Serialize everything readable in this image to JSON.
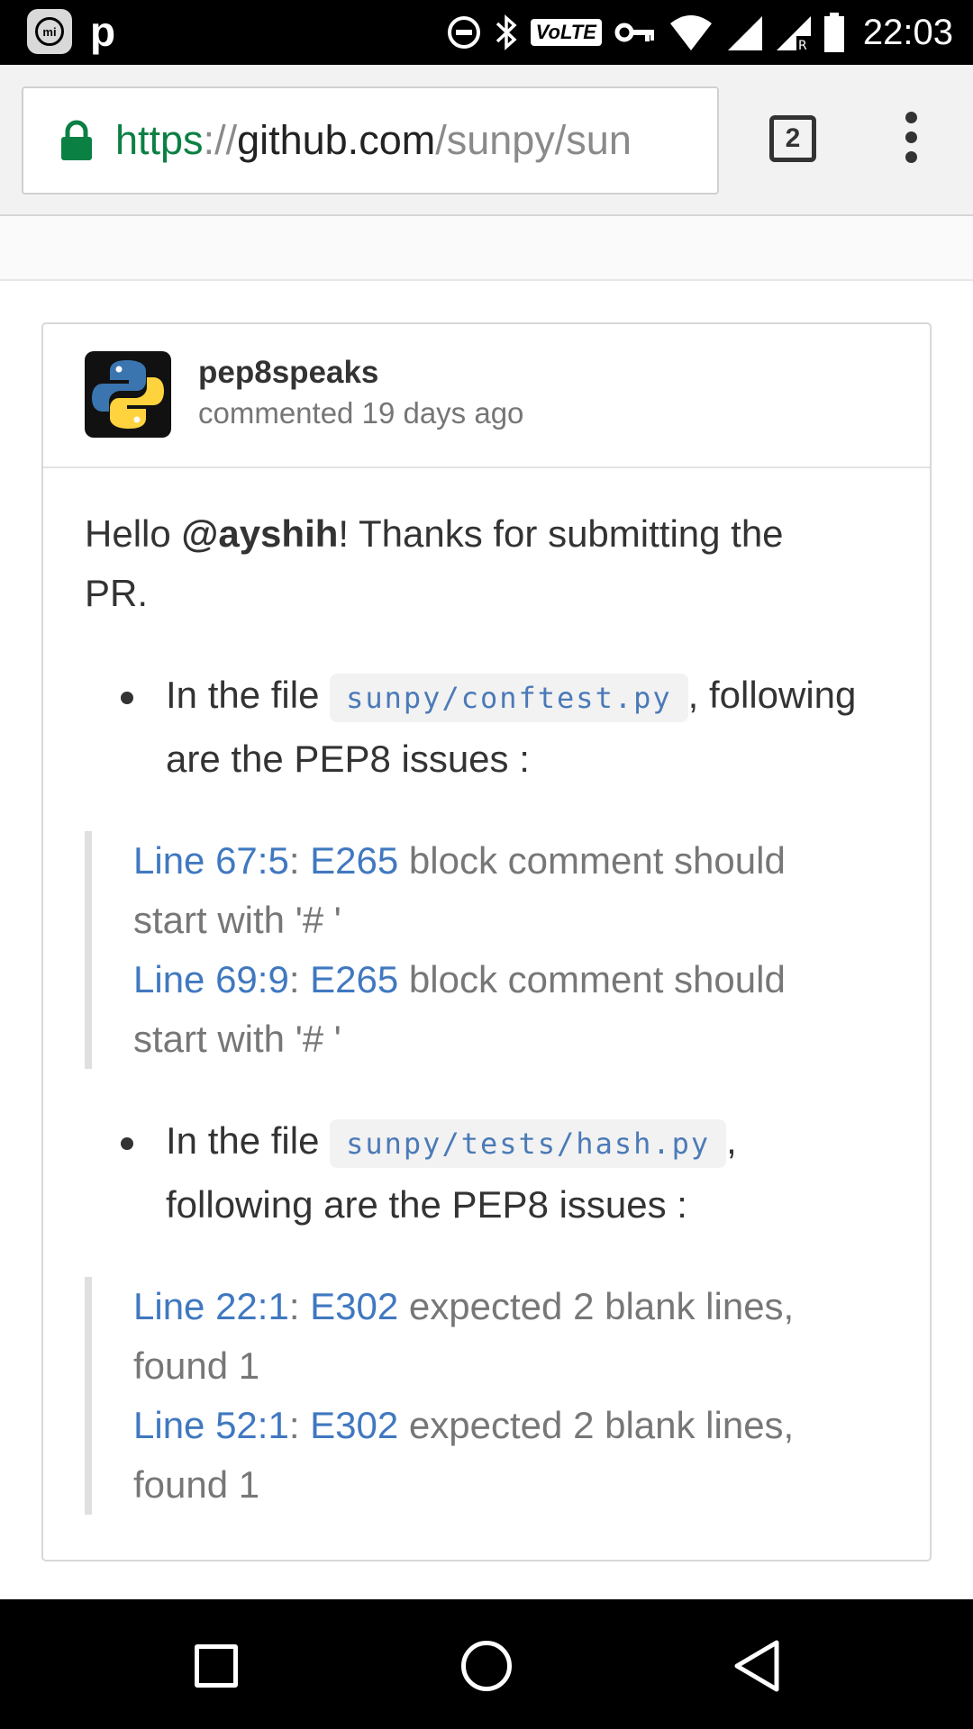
{
  "status_bar": {
    "time": "22:03",
    "app_letter": "p",
    "mi_label": "mi",
    "volte": "VoLTE",
    "icons": [
      "mi-icon",
      "p-icon",
      "do-not-disturb-icon",
      "bluetooth-icon",
      "volte-icon",
      "vpn-key-icon",
      "wifi-icon",
      "signal-icon",
      "signal-roaming-icon",
      "battery-icon"
    ]
  },
  "browser": {
    "url_scheme": "https",
    "url_sep": "://",
    "url_host": "github.com",
    "url_path": "/sunpy/sun",
    "tab_count": "2"
  },
  "comment": {
    "author": "pep8speaks",
    "meta_prefix": "commented ",
    "time_ago": "19 days ago",
    "greeting_prefix": "Hello ",
    "mention": "@ayshih",
    "greeting_suffix": "! Thanks for submitting the PR.",
    "files": [
      {
        "prefix": "In the file ",
        "filename": "sunpy/conftest.py",
        "suffix": ", following are the PEP8 issues :",
        "issues": [
          {
            "line": "Line 67:5",
            "colon": ": ",
            "code": "E265",
            "message": " block comment should start with '# '"
          },
          {
            "line": "Line 69:9",
            "colon": ": ",
            "code": "E265",
            "message": " block comment should start with '# '"
          }
        ]
      },
      {
        "prefix": "In the file ",
        "filename": "sunpy/tests/hash.py",
        "suffix": ", following are the PEP8 issues :",
        "issues": [
          {
            "line": "Line 22:1",
            "colon": ": ",
            "code": "E302",
            "message": " expected 2 blank lines, found 1"
          },
          {
            "line": "Line 52:1",
            "colon": ": ",
            "code": "E302",
            "message": " expected 2 blank lines, found 1"
          }
        ]
      }
    ]
  },
  "nav": {
    "icons": [
      "recent-apps-icon",
      "home-icon",
      "back-icon"
    ]
  },
  "colors": {
    "link": "#4078c0",
    "secure_green": "#0b8043",
    "code_text": "#4b7ab8"
  }
}
